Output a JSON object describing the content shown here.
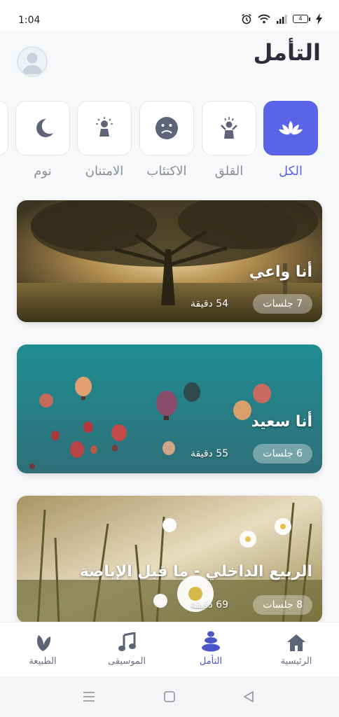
{
  "status_bar": {
    "time": "1:04",
    "battery": "4"
  },
  "header": {
    "title": "التأمل"
  },
  "categories": [
    {
      "label": "الكل",
      "icon": "lotus-icon",
      "active": true
    },
    {
      "label": "القلق",
      "icon": "stressed-person-icon",
      "active": false
    },
    {
      "label": "الاكتئاب",
      "icon": "sad-face-icon",
      "active": false
    },
    {
      "label": "الامتنان",
      "icon": "praying-person-icon",
      "active": false
    },
    {
      "label": "نوم",
      "icon": "moon-icon",
      "active": false
    }
  ],
  "cards": [
    {
      "title": "أنا واعي",
      "sessions": "7 جلسات",
      "duration": "54 دقيقة"
    },
    {
      "title": "أنا سعيد",
      "sessions": "6 جلسات",
      "duration": "55 دقيقة"
    },
    {
      "title": "الربيع الداخلي - ما قبل الإباضة",
      "sessions": "8 جلسات",
      "duration": "69 دقيقة"
    }
  ],
  "bottom_nav": [
    {
      "label": "الرئيسية",
      "icon": "home-icon",
      "active": false
    },
    {
      "label": "التأمل",
      "icon": "stones-icon",
      "active": true
    },
    {
      "label": "الموسيقى",
      "icon": "music-note-icon",
      "active": false
    },
    {
      "label": "الطبيعة",
      "icon": "leaf-icon",
      "active": false
    }
  ],
  "colors": {
    "accent": "#5b63e6",
    "nav_active": "#4a56c8"
  }
}
